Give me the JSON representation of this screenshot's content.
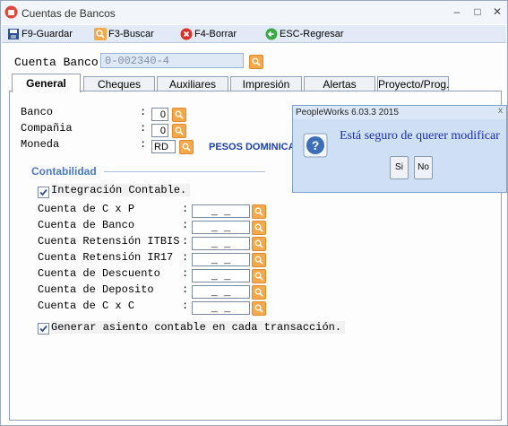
{
  "window": {
    "title": "Cuentas de Bancos"
  },
  "toolbar": {
    "guardar": "F9-Guardar",
    "buscar": "F3-Buscar",
    "borrar": "F4-Borrar",
    "regresar": "ESC-Regresar"
  },
  "header": {
    "cuenta_label": "Cuenta Banco :",
    "cuenta_value": "0-002340-4"
  },
  "tabs": [
    "General",
    "Cheques",
    "Auxiliares",
    "Impresión",
    "Alertas",
    "Proyecto/Prog."
  ],
  "general": {
    "banco_label": "Banco",
    "banco_value": "0",
    "compania_label": "Compañia",
    "compania_value": "0",
    "moneda_label": "Moneda",
    "moneda_value": "RD",
    "moneda_name": "PESOS DOMINICANOS",
    "colon": ":"
  },
  "contabilidad": {
    "title": "Contabilidad",
    "integracion_label": "Integración Contable.",
    "integracion_checked": true,
    "accounts": [
      {
        "label": "Cuenta de C x P",
        "value": "_ _"
      },
      {
        "label": "Cuenta de Banco",
        "value": "_ _"
      },
      {
        "label": "Cuenta Retensión ITBIS",
        "value": "_ _"
      },
      {
        "label": "Cuenta Retensión IR17",
        "value": "_ _"
      },
      {
        "label": "Cuenta de Descuento",
        "value": "_ _"
      },
      {
        "label": "Cuenta de Deposito",
        "value": "_ _"
      },
      {
        "label": "Cuenta de C x C",
        "value": "_ _"
      }
    ],
    "generar_label": "Generar asiento contable en cada transacción.",
    "generar_checked": true
  },
  "dialog": {
    "title": "PeopleWorks 6.03.3 2015",
    "message": "Está seguro de querer modificar",
    "yes_label": "Si",
    "no_label": "No",
    "close_label": "x"
  },
  "colors": {
    "accent_blue": "#1a3fb0",
    "search_orange": "#f5a94a",
    "dialog_bg": "#cfe0f5"
  }
}
